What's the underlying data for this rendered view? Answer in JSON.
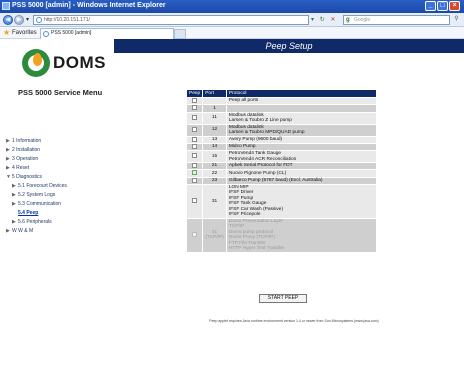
{
  "window": {
    "title": "PSS 5000 [admin] - Windows Internet Explorer",
    "controls": {
      "minimize": "_",
      "maximize": "□",
      "close": "×"
    }
  },
  "browser": {
    "back_icon": "back-arrow-icon",
    "forward_icon": "forward-arrow-icon",
    "url": "http://10.20.151.171/",
    "search_placeholder": "Google",
    "favorites_label": "Favorites",
    "tab_title": "PSS 5000 [admin]"
  },
  "sidebar": {
    "logo_text": "DOMS",
    "service_title": "PSS 5000 Service Menu",
    "items": [
      {
        "label": "1 Information",
        "level": 0
      },
      {
        "label": "2 Installation",
        "level": 0
      },
      {
        "label": "3 Operation",
        "level": 0
      },
      {
        "label": "4 Reset",
        "level": 0
      },
      {
        "label": "5 Diagnostics",
        "level": 0
      },
      {
        "label": "5.1 Forecourt Devices",
        "level": 1
      },
      {
        "label": "5.2 System Logs",
        "level": 1
      },
      {
        "label": "5.3 Communication",
        "level": 1
      },
      {
        "label": "5.4 Peep",
        "level": 1,
        "active": true
      },
      {
        "label": "5.6 Peripherals",
        "level": 1
      },
      {
        "label": "W W & M",
        "level": 0
      }
    ]
  },
  "main": {
    "title": "Peep Setup",
    "table": {
      "headers": [
        "Peep",
        "Port",
        "Protocol"
      ],
      "rows": [
        {
          "port": "",
          "protocol": [
            "Peep all ports"
          ],
          "checked": false,
          "disabled": false
        },
        {
          "port": "1",
          "protocol": [
            ""
          ],
          "checked": false,
          "disabled": false
        },
        {
          "port": "11",
          "protocol": [
            "Modbus datalink",
            "Larsen & Toubro Z Line pump"
          ],
          "checked": false,
          "disabled": false
        },
        {
          "port": "12",
          "protocol": [
            "Modbus datalink",
            "Larsen & Toubro MPD/QUAD pump"
          ],
          "checked": false,
          "disabled": false
        },
        {
          "port": "13",
          "protocol": [
            "Avery Pump (9600 baud)"
          ],
          "checked": false,
          "disabled": false
        },
        {
          "port": "14",
          "protocol": [
            "Midco Pump"
          ],
          "checked": false,
          "disabled": false
        },
        {
          "port": "15",
          "protocol": [
            "PetroVend4 Tank Gauge",
            "PetroVend4 ACR Reconciliation"
          ],
          "checked": false,
          "disabled": false
        },
        {
          "port": "21",
          "protocol": [
            "Apbek Serial Protocol for FDT"
          ],
          "checked": false,
          "disabled": false
        },
        {
          "port": "22",
          "protocol": [
            "Nuovo Pignone Pump (CL)"
          ],
          "checked": true,
          "disabled": false
        },
        {
          "port": "23",
          "protocol": [
            "Gilbarco Pump (5787 baud) (Excl. Australia)"
          ],
          "checked": false,
          "disabled": false
        },
        {
          "port": "31",
          "protocol": [
            "LON MIP",
            "IFSF Driver",
            "IFSF Pump",
            "IFSF Tank Gauge",
            "IFSF Car Wash (Passive)",
            "IFSF Pricepole"
          ],
          "checked": false,
          "disabled": false
        },
        {
          "port": "41\n(TCP/IP)",
          "protocol": [
            "Doms Presentation Layer",
            "TCP/IP",
            "Doms pump protocol",
            "Doms Proxy (TCP/IP)",
            "FTP File Transfer",
            "HTTP Hyper Text Transfer"
          ],
          "checked": false,
          "disabled": true
        }
      ]
    },
    "start_button": "START PEEP",
    "footnote": "Peep applet requires Java runtime environment version 1.4 or newer from Sun Microsystems (www.java.com)"
  }
}
